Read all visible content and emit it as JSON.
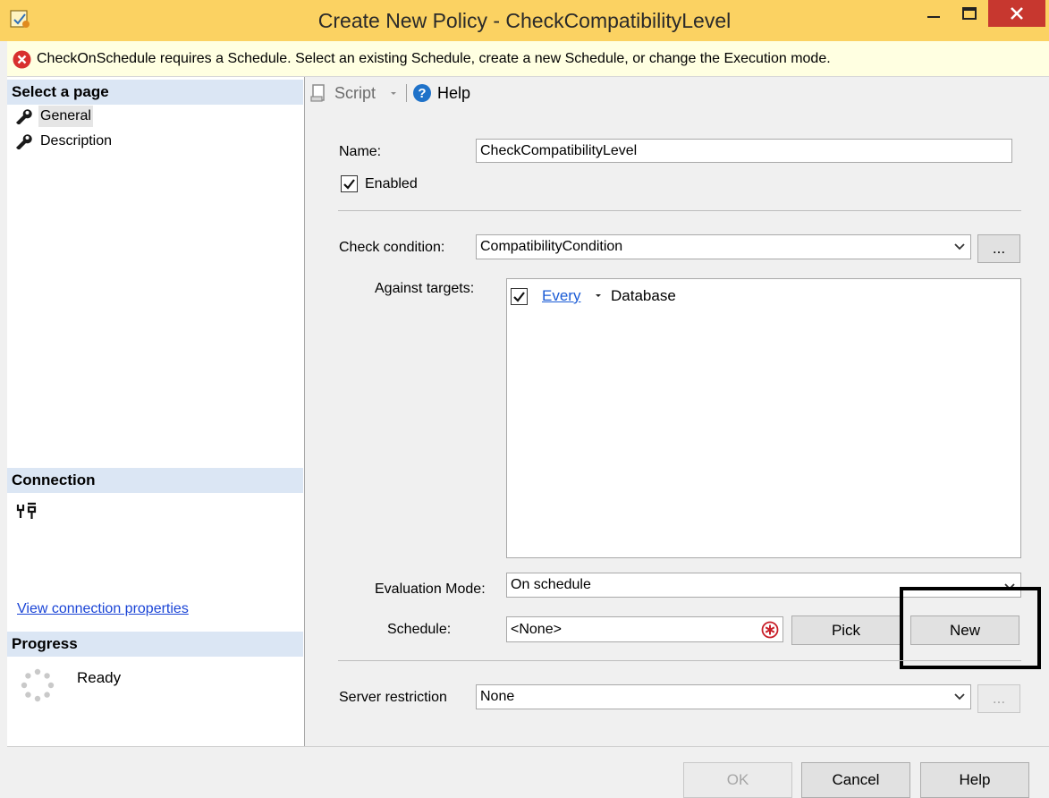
{
  "window": {
    "title": "Create New Policy - CheckCompatibilityLevel",
    "accent": "#fbd262",
    "close_color": "#c7372f"
  },
  "error_banner": {
    "message": "CheckOnSchedule requires a Schedule. Select an existing Schedule, create a new Schedule, or change the Execution mode.",
    "icon": "error-icon"
  },
  "left_panel": {
    "select_page_header": "Select a page",
    "pages": [
      {
        "label": "General",
        "icon": "wrench-icon",
        "selected": true
      },
      {
        "label": "Description",
        "icon": "wrench-icon",
        "selected": false
      }
    ],
    "connection_header": "Connection",
    "connection_icon": "connection-icon",
    "view_connection_properties": "View connection properties",
    "progress_header": "Progress",
    "progress_status": "Ready"
  },
  "toolbar": {
    "script_label": "Script",
    "help_label": "Help"
  },
  "form": {
    "name_label": "Name:",
    "name_value": "CheckCompatibilityLevel",
    "enabled_label": "Enabled",
    "enabled_checked": true,
    "check_condition_label": "Check condition:",
    "check_condition_value": "CompatibilityCondition",
    "browse_label": "...",
    "against_targets_label": "Against targets:",
    "target_every": "Every",
    "target_type": "Database",
    "target_checked": true,
    "evaluation_mode_label": "Evaluation Mode:",
    "evaluation_mode_value": "On schedule",
    "schedule_label": "Schedule:",
    "schedule_value": "<None>",
    "pick_label": "Pick",
    "new_label": "New",
    "server_restriction_label": "Server restriction",
    "server_restriction_value": "None"
  },
  "buttons": {
    "ok": "OK",
    "cancel": "Cancel",
    "help": "Help"
  }
}
